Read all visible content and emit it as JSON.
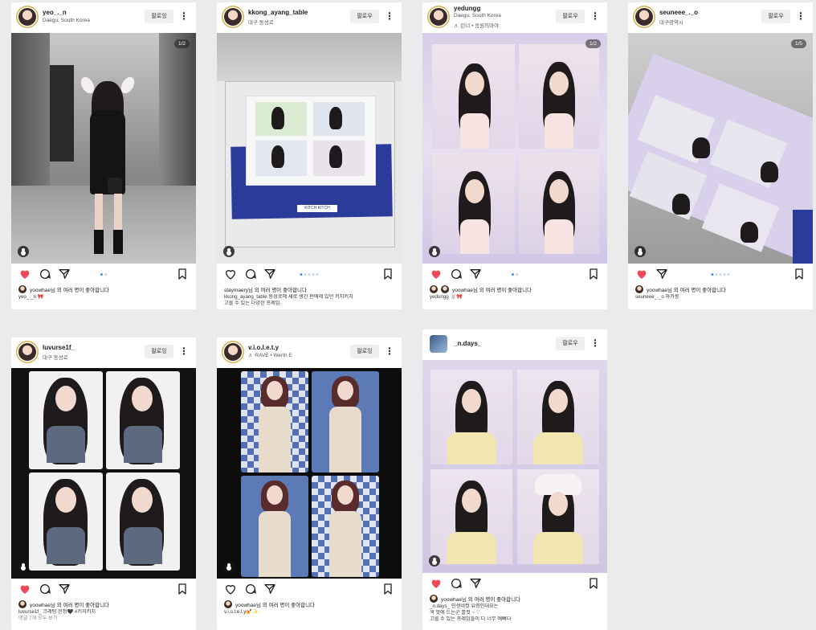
{
  "posts": [
    {
      "username": "yeo_._n",
      "location": "Daegu, South Korea",
      "follow": "팔로잉",
      "counter": "1/2",
      "likes": "yoowhae님 외 여러 명이 좋아합니다",
      "caption": [
        "yeo_._n 🎀"
      ]
    },
    {
      "username": "kkong_ayang_table",
      "location": "대구 동성로",
      "follow": "팔로우",
      "counter": "",
      "likes": "staymaery님 외 여러 명이 좋아합니다",
      "caption": [
        "kkong_ayang_table 동성로에 새로 생긴 판매제 있던 키치키치",
        "고를 수 있는 다양한 프레임"
      ]
    },
    {
      "username": "yedungg",
      "location": "Daegu, South Korea",
      "music": "♬ 린너 • 응원의마야",
      "follow": "팔로우",
      "counter": "1/2",
      "likes": "yoowhae님 외 여러 명이 좋아합니다",
      "caption": [
        "yedungg 🐰🎀"
      ]
    },
    {
      "username": "seuneee_._o",
      "location": "대구광역시",
      "follow": "팔로우",
      "counter": "1/5",
      "likes": "yoowhae님 외 여러 명이 좋아합니다",
      "caption": [
        "seuneee_._o 마카롱"
      ]
    },
    {
      "username": "luvurse1f_",
      "location": "대구 동성로",
      "follow": "팔로잉",
      "counter": "",
      "likes": "yoowhae님 외 여러 명이 좋아합니다",
      "caption": [
        "luvurse1f_ 크레팅 한정🖤 #키치키치",
        "댓글 7개 모두 보기"
      ]
    },
    {
      "username": "v.i.o.l.e.t.y",
      "location": "♬ RAVE • Werth E",
      "follow": "팔로잉",
      "counter": "",
      "likes": "yoowhae님 외 여러 명이 좋아합니다",
      "caption": [
        "v.i.o.l.e.t.y💅✨"
      ]
    },
    {
      "username": "_n.days_",
      "location": "",
      "follow": "팔로우",
      "counter": "",
      "likes": "yoowhae님 외 여러 명이 좋아합니다",
      "caption": [
        "_n.days_ 인생네컷 유령인데요는",
        "색 멋에 드는군 꿀컷 ~ ♡",
        "고를 수 있는 프레임들이 다 너무 예뻐다"
      ]
    }
  ],
  "icons": {
    "heart": "heart-icon",
    "comment": "comment-icon",
    "share": "share-icon",
    "save": "bookmark-icon",
    "more": "more-icon"
  },
  "colors": {
    "like_red": "#ed4956",
    "accent_blue": "#3897f0",
    "background": "#ebebeb"
  }
}
